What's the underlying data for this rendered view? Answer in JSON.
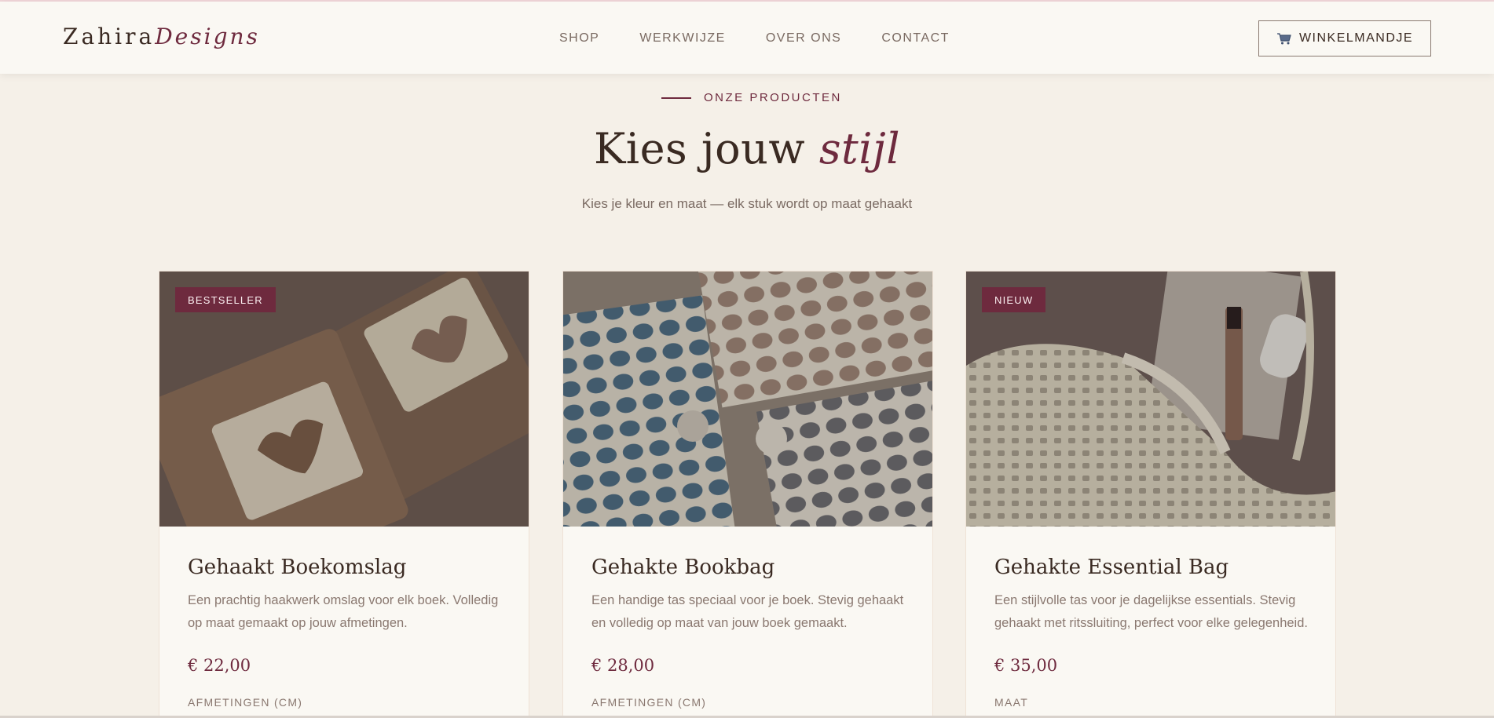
{
  "brand": {
    "name_main": "Zahira",
    "name_accent": "Designs"
  },
  "nav": [
    {
      "label": "SHOP"
    },
    {
      "label": "WERKWIJZE"
    },
    {
      "label": "OVER ONS"
    },
    {
      "label": "CONTACT"
    }
  ],
  "cart": {
    "label": "WINKELMANDJE",
    "icon": "shopping-cart-icon"
  },
  "section": {
    "eyebrow": "ONZE PRODUCTEN",
    "title_main": "Kies jouw ",
    "title_accent": "stijl",
    "subtitle": "Kies je kleur en maat — elk stuk wordt op maat gehaakt"
  },
  "products": [
    {
      "badge": "BESTSELLER",
      "title": "Gehaakt Boekomslag",
      "description": "Een prachtig haakwerk omslag voor elk boek. Volledig op maat gemaakt op jouw afmetingen.",
      "price": "€ 22,00",
      "option_label": "AFMETINGEN (CM)"
    },
    {
      "badge": "",
      "title": "Gehakte Bookbag",
      "description": "Een handige tas speciaal voor je boek. Stevig gehaakt en volledig op maat van jouw boek gemaakt.",
      "price": "€ 28,00",
      "option_label": "AFMETINGEN (CM)"
    },
    {
      "badge": "NIEUW",
      "title": "Gehakte Essential Bag",
      "description": "Een stijlvolle tas voor je dagelijkse essentials. Stevig gehaakt met ritssluiting, perfect voor elke gelegenheid.",
      "price": "€ 35,00",
      "option_label": "MAAT"
    }
  ],
  "colors": {
    "accent": "#6e2a3e",
    "background": "#f5f0e8",
    "header": "#faf8f3",
    "text": "#3a2a22",
    "muted": "#7a6a62"
  }
}
